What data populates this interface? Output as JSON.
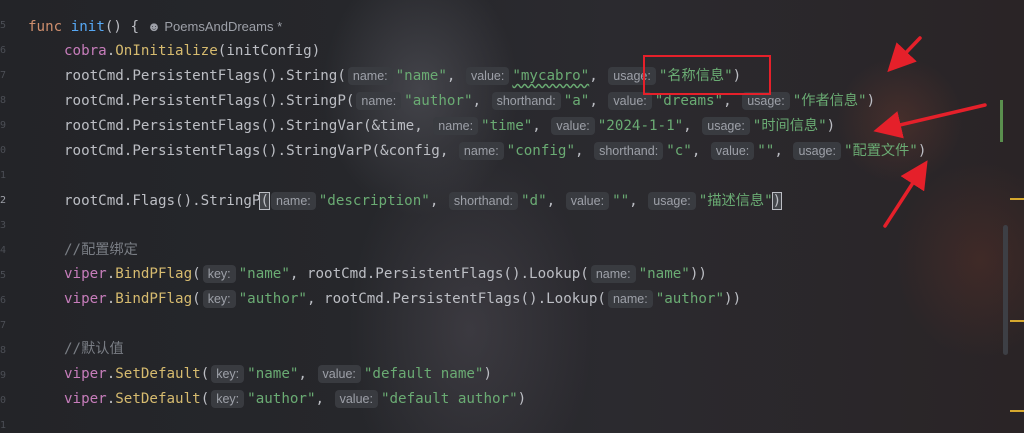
{
  "author_hint": "PoemsAndDreams *",
  "lines": {
    "func_kw": "func",
    "func_name": "init",
    "func_rest": "() {",
    "l1": {
      "pkg": "cobra",
      "dot": ".",
      "method": "OnInitialize",
      "open": "(",
      "arg": "initConfig",
      "close": ")"
    },
    "l2": {
      "obj": "rootCmd.PersistentFlags().String(",
      "h1": "name:",
      "s1": "\"name\"",
      "c1": ",",
      "h2": "value:",
      "s2": "\"mycabro\"",
      "c2": ",",
      "h3": "usage:",
      "s3": "\"名称信息\"",
      "end": ")"
    },
    "l3": {
      "obj": "rootCmd.PersistentFlags().StringP(",
      "h1": "name:",
      "s1": "\"author\"",
      "c1": ",",
      "h2": "shorthand:",
      "s2": "\"a\"",
      "c2": ",",
      "h3": "value:",
      "s3": "\"dreams\"",
      "c3": ",",
      "h4": "usage:",
      "s4": "\"作者信息\"",
      "end": ")"
    },
    "l4": {
      "obj": "rootCmd.PersistentFlags().StringVar(&time,",
      "h1": "name:",
      "s1": "\"time\"",
      "c1": ",",
      "h2": "value:",
      "s2": "\"2024-1-1\"",
      "c2": ",",
      "h3": "usage:",
      "s3": "\"时间信息\"",
      "end": ")"
    },
    "l5": {
      "obj": "rootCmd.PersistentFlags().StringVarP(&config,",
      "h1": "name:",
      "s1": "\"config\"",
      "c1": ",",
      "h2": "shorthand:",
      "s2": "\"c\"",
      "c2": ",",
      "h3": "value:",
      "s3": "\"\"",
      "c3": ",",
      "h4": "usage:",
      "s4": "\"配置文件\"",
      "end": ")"
    },
    "l6": {
      "obj": "rootCmd.Flags().StringP",
      "open": "(",
      "h1": "name:",
      "s1": "\"description\"",
      "c1": ",",
      "h2": "shorthand:",
      "s2": "\"d\"",
      "c2": ",",
      "h3": "value:",
      "s3": "\"\"",
      "c3": ",",
      "h4": "usage:",
      "s4": "\"描述信息\"",
      "end": ")"
    },
    "c1": "//配置绑定",
    "l7": {
      "pkg": "viper",
      "dot": ".",
      "method": "BindPFlag",
      "open": "(",
      "h1": "key:",
      "s1": "\"name\"",
      "mid": ", rootCmd.PersistentFlags().Lookup(",
      "h2": "name:",
      "s2": "\"name\"",
      "end": "))"
    },
    "l8": {
      "pkg": "viper",
      "dot": ".",
      "method": "BindPFlag",
      "open": "(",
      "h1": "key:",
      "s1": "\"author\"",
      "mid": ", rootCmd.PersistentFlags().Lookup(",
      "h2": "name:",
      "s2": "\"author\"",
      "end": "))"
    },
    "c2": "//默认值",
    "l9": {
      "pkg": "viper",
      "dot": ".",
      "method": "SetDefault",
      "open": "(",
      "h1": "key:",
      "s1": "\"name\"",
      "c1": ",",
      "h2": "value:",
      "s2": "\"default name\"",
      "end": ")"
    },
    "l10": {
      "pkg": "viper",
      "dot": ".",
      "method": "SetDefault",
      "open": "(",
      "h1": "key:",
      "s1": "\"author\"",
      "c1": ",",
      "h2": "value:",
      "s2": "\"default author\"",
      "end": ")"
    }
  },
  "gutter": [
    "5",
    "6",
    "7",
    "8",
    "9",
    "0",
    "1",
    "2",
    "3",
    "4",
    "5",
    "6",
    "7",
    "8",
    "9",
    "0",
    "1"
  ],
  "colors": {
    "annotation": "#e5202a",
    "string": "#6aab73",
    "keyword": "#cf8e6d"
  }
}
